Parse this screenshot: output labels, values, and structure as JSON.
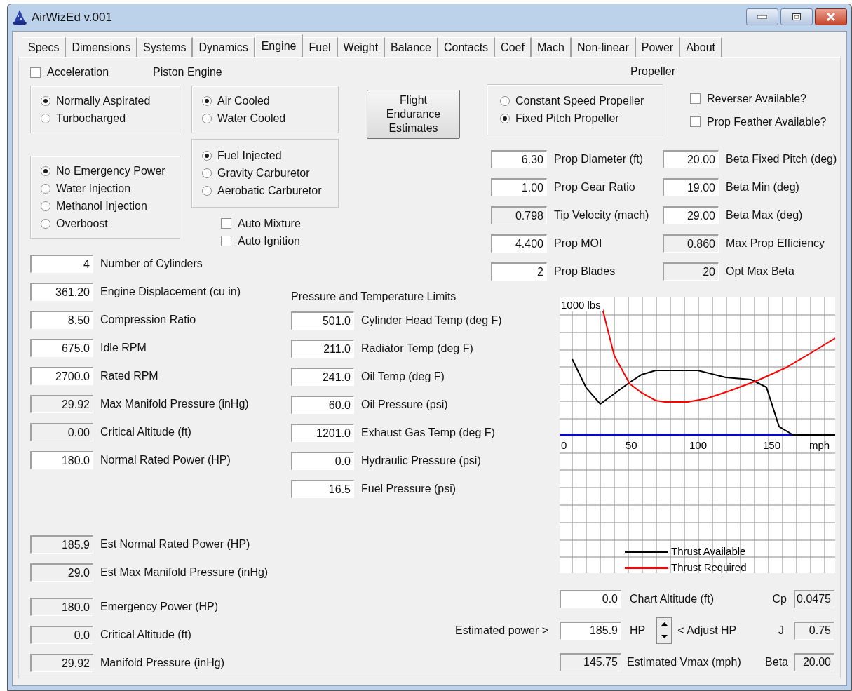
{
  "window": {
    "title": "AirWizEd v.001"
  },
  "tabs": [
    {
      "label": "Specs",
      "selected": false
    },
    {
      "label": "Dimensions",
      "selected": false
    },
    {
      "label": "Systems",
      "selected": false
    },
    {
      "label": "Dynamics",
      "selected": false
    },
    {
      "label": "Engine",
      "selected": true
    },
    {
      "label": "Fuel",
      "selected": false
    },
    {
      "label": "Weight",
      "selected": false
    },
    {
      "label": "Balance",
      "selected": false
    },
    {
      "label": "Contacts",
      "selected": false
    },
    {
      "label": "Coef",
      "selected": false
    },
    {
      "label": "Mach",
      "selected": false
    },
    {
      "label": "Non-linear",
      "selected": false
    },
    {
      "label": "Power",
      "selected": false
    },
    {
      "label": "About",
      "selected": false
    }
  ],
  "acceleration": {
    "label": "Acceleration",
    "checked": false
  },
  "piston_engine_label": "Piston Engine",
  "aspiration": [
    {
      "label": "Normally Aspirated",
      "selected": true
    },
    {
      "label": "Turbocharged",
      "selected": false
    }
  ],
  "cooling": [
    {
      "label": "Air Cooled",
      "selected": true
    },
    {
      "label": "Water Cooled",
      "selected": false
    }
  ],
  "emergency_power": [
    {
      "label": "No Emergency Power",
      "selected": true
    },
    {
      "label": "Water Injection",
      "selected": false
    },
    {
      "label": "Methanol Injection",
      "selected": false
    },
    {
      "label": "Overboost",
      "selected": false
    }
  ],
  "fuel_system": [
    {
      "label": "Fuel Injected",
      "selected": true
    },
    {
      "label": "Gravity Carburetor",
      "selected": false
    },
    {
      "label": "Aerobatic Carburetor",
      "selected": false
    }
  ],
  "engine_options": [
    {
      "label": "Auto Mixture",
      "checked": false
    },
    {
      "label": "Auto Ignition",
      "checked": false
    }
  ],
  "flight_button": "Flight Endurance Estimates",
  "propeller": {
    "title": "Propeller",
    "type": [
      {
        "label": "Constant Speed Propeller",
        "selected": false
      },
      {
        "label": "Fixed Pitch Propeller",
        "selected": true
      }
    ],
    "options": [
      {
        "label": "Reverser Available?",
        "checked": false
      },
      {
        "label": "Prop Feather Available?",
        "checked": false
      }
    ],
    "fields": [
      {
        "value": "6.30",
        "label": "Prop Diameter (ft)",
        "readonly": false
      },
      {
        "value": "20.00",
        "label": "Beta Fixed Pitch (deg)",
        "readonly": false
      },
      {
        "value": "1.00",
        "label": "Prop Gear Ratio",
        "readonly": false
      },
      {
        "value": "19.00",
        "label": "Beta Min (deg)",
        "readonly": false
      },
      {
        "value": "0.798",
        "label": "Tip Velocity (mach)",
        "readonly": true
      },
      {
        "value": "29.00",
        "label": "Beta Max (deg)",
        "readonly": false
      },
      {
        "value": "4.400",
        "label": "Prop MOI",
        "readonly": false
      },
      {
        "value": "0.860",
        "label": "Max Prop Efficiency",
        "readonly": true
      },
      {
        "value": "2",
        "label": "Prop Blades",
        "readonly": false
      },
      {
        "value": "20",
        "label": "Opt Max Beta",
        "readonly": true
      }
    ]
  },
  "engine_fields": [
    {
      "value": "4",
      "label": "Number of Cylinders",
      "readonly": false
    },
    {
      "value": "361.20",
      "label": "Engine Displacement (cu in)",
      "readonly": false
    },
    {
      "value": "8.50",
      "label": "Compression Ratio",
      "readonly": false
    },
    {
      "value": "675.0",
      "label": "Idle RPM",
      "readonly": false
    },
    {
      "value": "2700.0",
      "label": "Rated RPM",
      "readonly": false
    },
    {
      "value": "29.92",
      "label": "Max Manifold Pressure (inHg)",
      "readonly": true
    },
    {
      "value": "0.00",
      "label": "Critical Altitude (ft)",
      "readonly": true
    },
    {
      "value": "180.0",
      "label": "Normal Rated Power (HP)",
      "readonly": false
    }
  ],
  "estimated_fields": [
    {
      "value": "185.9",
      "label": "Est Normal Rated Power (HP)",
      "readonly": true
    },
    {
      "value": "29.0",
      "label": "Est Max Manifold Pressure (inHg)",
      "readonly": true
    }
  ],
  "emergency_fields": [
    {
      "value": "180.0",
      "label": "Emergency Power (HP)",
      "readonly": true
    },
    {
      "value": "0.0",
      "label": "Critical Altitude (ft)",
      "readonly": true
    },
    {
      "value": "29.92",
      "label": "Manifold Pressure (inHg)",
      "readonly": true
    }
  ],
  "limits": {
    "title": "Pressure and Temperature Limits",
    "fields": [
      {
        "value": "501.0",
        "label": "Cylinder Head Temp (deg F)",
        "readonly": false
      },
      {
        "value": "211.0",
        "label": "Radiator Temp (deg F)",
        "readonly": false
      },
      {
        "value": "241.0",
        "label": "Oil Temp (deg F)",
        "readonly": false
      },
      {
        "value": "60.0",
        "label": "Oil Pressure (psi)",
        "readonly": false
      },
      {
        "value": "1201.0",
        "label": "Exhaust Gas Temp (deg F)",
        "readonly": false
      },
      {
        "value": "0.0",
        "label": "Hydraulic Pressure (psi)",
        "readonly": false
      },
      {
        "value": "16.5",
        "label": "Fuel Pressure (psi)",
        "readonly": false
      }
    ]
  },
  "chart": {
    "y_unit": "1000 lbs",
    "x_labels": [
      "0",
      "50",
      "100",
      "150"
    ],
    "x_unit": "mph",
    "legend": [
      {
        "label": "Thrust Available",
        "color": "#000000"
      },
      {
        "label": "Thrust Required",
        "color": "#ff0000"
      }
    ]
  },
  "chart_controls": {
    "chart_altitude": {
      "value": "0.0",
      "label": "Chart Altitude (ft)",
      "readonly": false
    },
    "cp": {
      "label": "Cp",
      "value": "0.0475",
      "readonly": true
    },
    "estimated_power": {
      "prefix": "Estimated power >",
      "value": "185.9",
      "unit": "HP",
      "adjust_label": "< Adjust HP",
      "readonly": false
    },
    "j": {
      "label": "J",
      "value": "0.75",
      "readonly": true
    },
    "vmax": {
      "value": "145.75",
      "label": "Estimated Vmax (mph)",
      "readonly": true
    },
    "beta": {
      "label": "Beta",
      "value": "20.00",
      "readonly": true
    }
  }
}
